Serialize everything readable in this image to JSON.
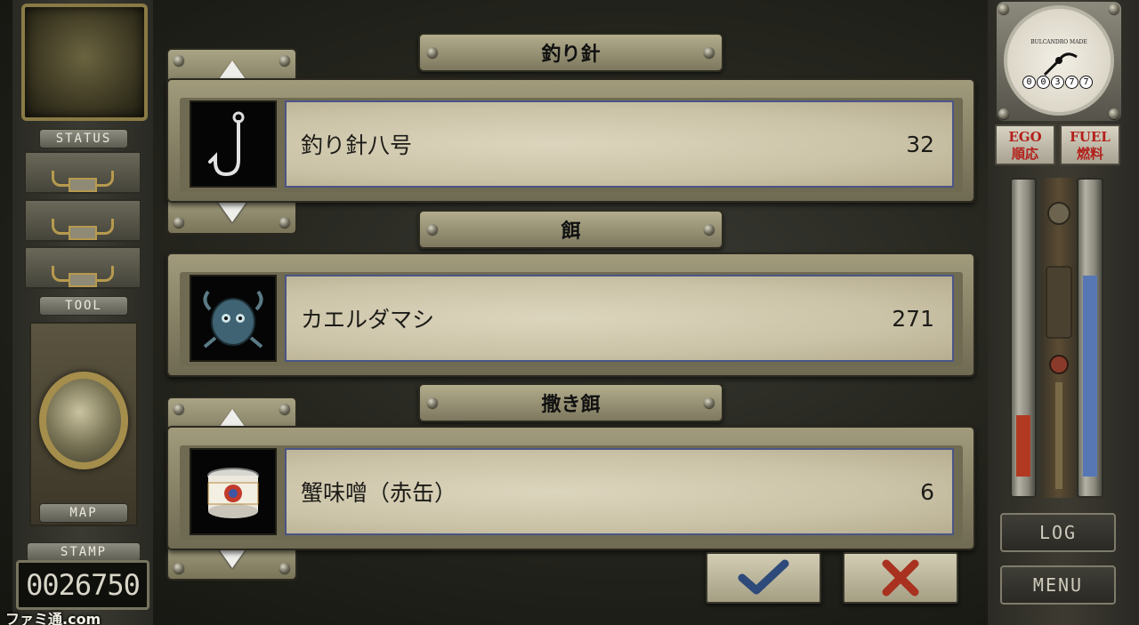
{
  "left_panel": {
    "status_label": "STATUS",
    "tool_label": "TOOL",
    "map_label": "MAP",
    "stamp_label": "STAMP",
    "stamp_value": "0026750"
  },
  "sections": [
    {
      "title": "釣り針",
      "item_name": "釣り針八号",
      "count": "32",
      "icon": "fishing-hook-icon",
      "has_arrows": true
    },
    {
      "title": "餌",
      "item_name": "カエルダマシ",
      "count": "271",
      "icon": "bait-bug-icon",
      "has_arrows": false
    },
    {
      "title": "撒き餌",
      "item_name": "蟹味噌（赤缶）",
      "count": "6",
      "icon": "crab-can-icon",
      "has_arrows": true
    }
  ],
  "actions": {
    "confirm_icon": "check-icon",
    "cancel_icon": "cross-icon",
    "confirm_color": "#2e4a7a",
    "cancel_color": "#a8321f"
  },
  "right_panel": {
    "gauge_brand": "BULCANDRO MADE",
    "odometer": [
      "0",
      "0",
      "3",
      "7",
      "7"
    ],
    "ego_label": "EGO",
    "ego_jp": "順応",
    "fuel_label": "FUEL",
    "fuel_jp": "燃料",
    "ego_level": 0.22,
    "fuel_level": 0.72,
    "ego_color": "#b23a22",
    "fuel_color": "#5677b4",
    "log_label": "LOG",
    "menu_label": "MENU"
  },
  "watermark": "ファミ通.com"
}
